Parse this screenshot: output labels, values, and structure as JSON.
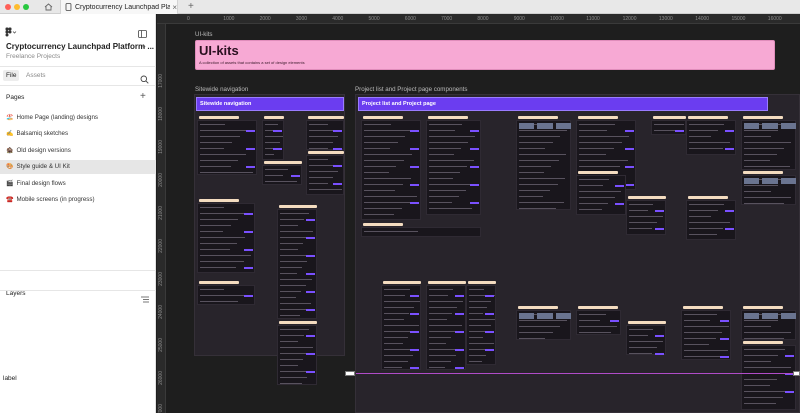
{
  "titlebar": {
    "traffic_colors": [
      "#ff5f57",
      "#febc2e",
      "#28c840"
    ],
    "home_icon": "home-icon",
    "tab_title": "Cryptocurrency Launchpad Platf",
    "tab_close": "×",
    "new_tab": "+"
  },
  "panel": {
    "file_name": "Cryptocurrency Launchpad Platform ...",
    "project": "Freelance Projects",
    "tabs": [
      "File",
      "Assets"
    ],
    "pages_heading": "Pages",
    "add_symbol": "+",
    "pages": [
      {
        "icon": "🏖️",
        "label": "Home Page (landing) designs",
        "active": false
      },
      {
        "icon": "✍️",
        "label": "Balsamiq sketches",
        "active": false
      },
      {
        "icon": "🏚️",
        "label": "Old design versions",
        "active": false
      },
      {
        "icon": "🎨",
        "label": "Style guide & UI Kit",
        "active": true
      },
      {
        "icon": "🎬",
        "label": "Final design flows",
        "active": false
      },
      {
        "icon": "☎️",
        "label": "Mobile screens (in progress)",
        "active": false
      }
    ],
    "layers_heading": "Layers",
    "layer_label": "label"
  },
  "rulers": {
    "top": [
      "0",
      "1000",
      "2000",
      "3000",
      "4000",
      "5000",
      "6000",
      "7000",
      "8000",
      "9000",
      "10000",
      "11000",
      "12000",
      "13000",
      "14000",
      "15000",
      "16000"
    ],
    "left": [
      "17000",
      "18000",
      "19000",
      "20000",
      "21000",
      "22000",
      "23000",
      "24000",
      "25000",
      "26000",
      "27000"
    ]
  },
  "canvas": {
    "uikit_label": "UI-kits",
    "uikit_title": "UI-kits",
    "uikit_desc": "A collection of assets that contains a set of design elements",
    "nav_label": "Sitewide navigation",
    "nav_header": "Sitewide navigation",
    "project_label": "Project list and Project page components",
    "project_header": "Project list and Project page"
  },
  "colors": {
    "accent_purple": "#6b3df0",
    "banner_pink": "#f7a9d4",
    "frame_dark": "#28242b",
    "selection": "#b04cc8"
  }
}
